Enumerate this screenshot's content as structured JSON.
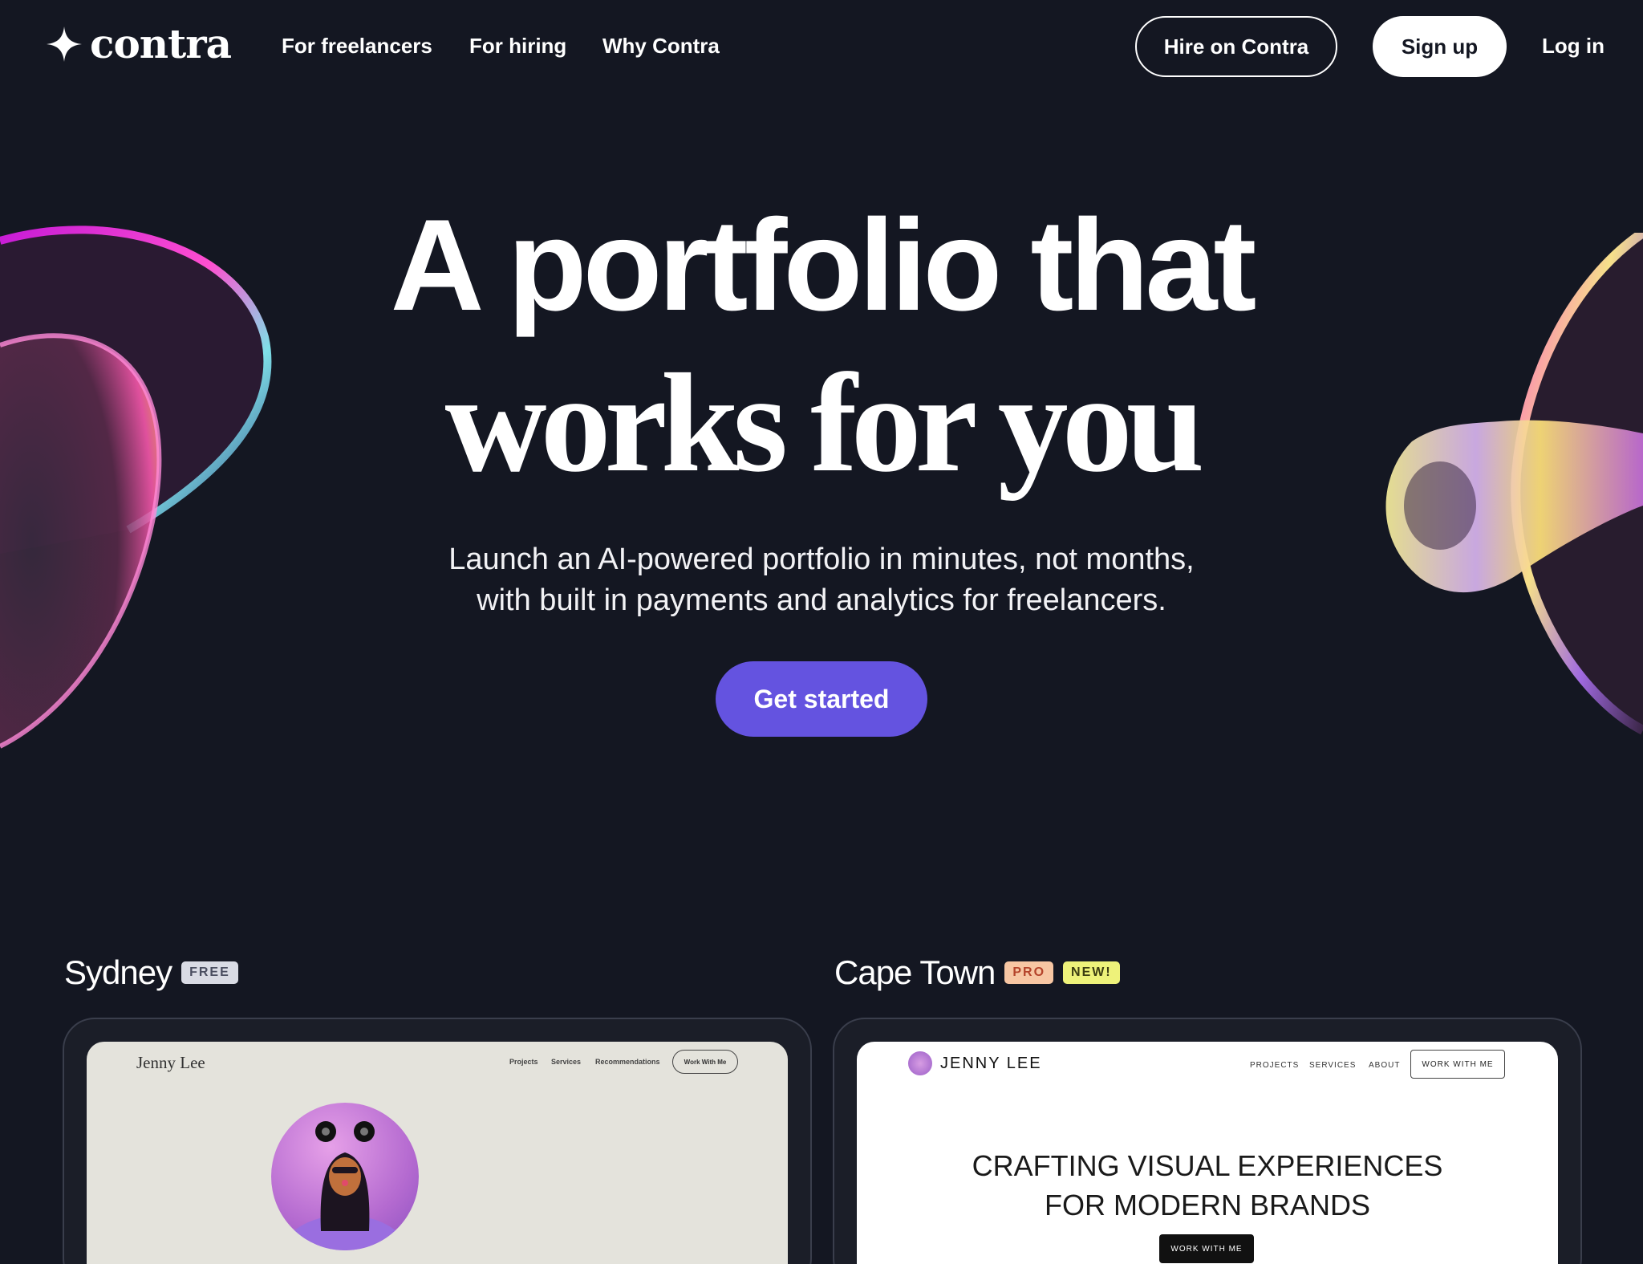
{
  "brand": {
    "name": "contra"
  },
  "nav": {
    "links": [
      "For freelancers",
      "For hiring",
      "Why Contra"
    ],
    "hire_label": "Hire on Contra",
    "signup_label": "Sign up",
    "login_label": "Log in"
  },
  "hero": {
    "line1": "A portfolio that",
    "line2": "works for you",
    "subtitle_line1": "Launch an AI-powered portfolio in minutes, not months,",
    "subtitle_line2": "with built in payments and analytics for freelancers.",
    "cta_label": "Get started"
  },
  "templates": [
    {
      "name": "Sydney",
      "badges": [
        "FREE"
      ],
      "preview": {
        "person": "Jenny Lee",
        "links": [
          "Projects",
          "Services",
          "Recommendations"
        ],
        "button": "Work With Me"
      }
    },
    {
      "name": "Cape Town",
      "badges": [
        "PRO",
        "NEW!"
      ],
      "preview": {
        "person": "JENNY LEE",
        "links": [
          "PROJECTS",
          "SERVICES",
          "ABOUT"
        ],
        "button": "WORK WITH ME",
        "headline_line1": "CRAFTING VISUAL EXPERIENCES",
        "headline_line2": "FOR MODERN BRANDS",
        "cta": "WORK WITH ME"
      }
    }
  ],
  "colors": {
    "background": "#141722",
    "accent": "#6453e0",
    "badge_free": "#d9dbe4",
    "badge_pro": "#f7c6a3",
    "badge_new": "#eef27a"
  }
}
